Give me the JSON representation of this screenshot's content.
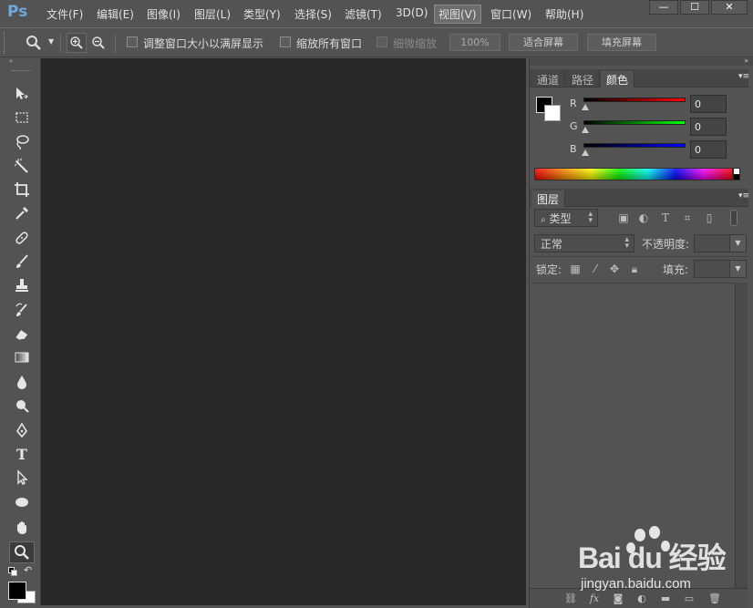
{
  "app": {
    "logo": "Ps",
    "menu": [
      {
        "label": "文件(F)"
      },
      {
        "label": "编辑(E)"
      },
      {
        "label": "图像(I)"
      },
      {
        "label": "图层(L)"
      },
      {
        "label": "类型(Y)"
      },
      {
        "label": "选择(S)"
      },
      {
        "label": "滤镜(T)"
      },
      {
        "label": "3D(D)"
      },
      {
        "label": "视图(V)",
        "active": true
      },
      {
        "label": "窗口(W)"
      },
      {
        "label": "帮助(H)"
      }
    ],
    "window_controls": {
      "minimize": "—",
      "maximize": "☐",
      "close": "✕"
    }
  },
  "options_bar": {
    "tool_icon": "zoom-icon",
    "resize_windows_label": "调整窗口大小以满屏显示",
    "zoom_all_windows_label": "缩放所有窗口",
    "scrubby_zoom_label": "细微缩放",
    "zoom_percent": "100%",
    "fit_screen_label": "适合屏幕",
    "fill_screen_label": "填充屏幕"
  },
  "toolbar": {
    "tools": [
      "move-tool-icon",
      "marquee-tool-icon",
      "lasso-tool-icon",
      "magic-wand-tool-icon",
      "crop-tool-icon",
      "eyedropper-tool-icon",
      "spot-healing-tool-icon",
      "brush-tool-icon",
      "clone-stamp-tool-icon",
      "history-brush-tool-icon",
      "eraser-tool-icon",
      "gradient-tool-icon",
      "blur-tool-icon",
      "dodge-tool-icon",
      "pen-tool-icon",
      "type-tool-icon",
      "path-selection-tool-icon",
      "ellipse-tool-icon",
      "hand-tool-icon",
      "zoom-tool-icon"
    ],
    "type_tool_glyph": "T",
    "active_tool": "zoom-tool-icon"
  },
  "color_panel": {
    "tabs": [
      {
        "label": "通道"
      },
      {
        "label": "路径"
      },
      {
        "label": "颜色",
        "active": true
      }
    ],
    "channels": [
      {
        "label": "R",
        "value": "0",
        "color": "#ff0000"
      },
      {
        "label": "G",
        "value": "0",
        "color": "#00ff00"
      },
      {
        "label": "B",
        "value": "0",
        "color": "#0000ff"
      }
    ],
    "foreground_color": "#000000",
    "background_color": "#ffffff"
  },
  "layers_panel": {
    "tab_label": "图层",
    "filter_kind": "类型",
    "blend_mode": "正常",
    "opacity_label": "不透明度:",
    "lock_label": "锁定:",
    "fill_label": "填充:"
  },
  "watermark": {
    "brand": "Bai du 经验",
    "url": "jingyan.baidu.com"
  }
}
